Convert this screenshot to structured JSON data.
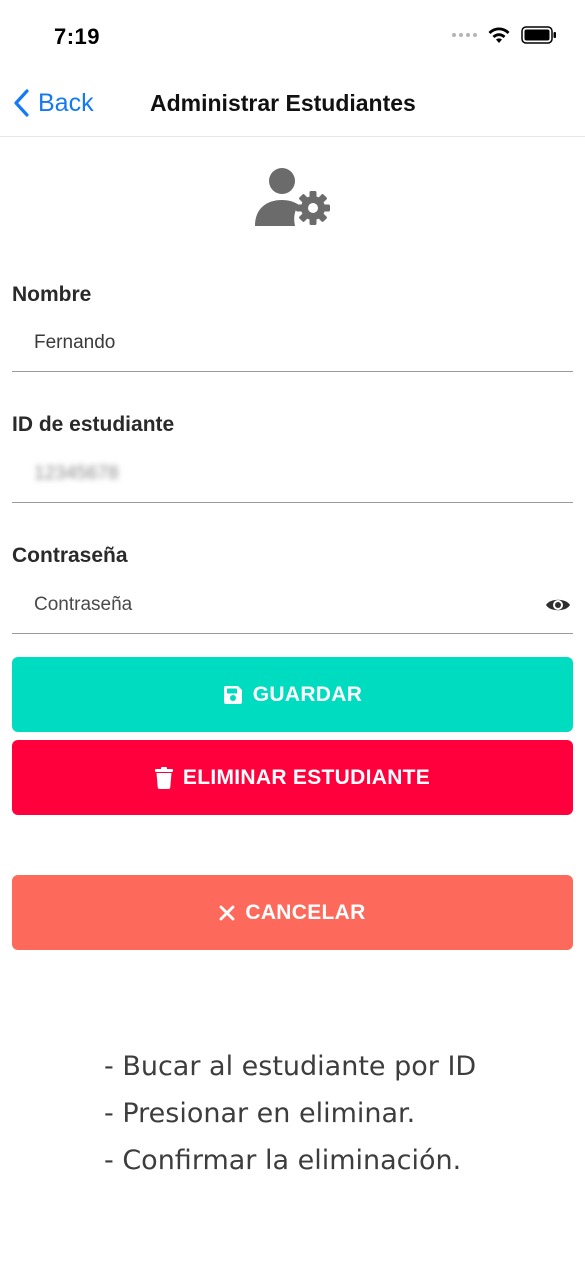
{
  "status_bar": {
    "time": "7:19"
  },
  "nav": {
    "back_label": "Back",
    "title": "Administrar Estudiantes"
  },
  "hero": {
    "icon": "user-cog-icon"
  },
  "form": {
    "name": {
      "label": "Nombre",
      "value": "Fernando"
    },
    "student_id": {
      "label": "ID de estudiante",
      "value": "12345678"
    },
    "password": {
      "label": "Contraseña",
      "placeholder": "Contraseña"
    }
  },
  "buttons": {
    "save": {
      "label": "GUARDAR",
      "icon": "floppy-disk-icon",
      "color": "#00dcbf"
    },
    "delete": {
      "label": "ELIMINAR ESTUDIANTE",
      "icon": "trash-icon",
      "color": "#ff003c"
    },
    "cancel": {
      "label": "CANCELAR",
      "icon": "close-icon",
      "color": "#fd6a5b"
    }
  },
  "instructions": [
    "- Bucar al estudiante por ID",
    "- Presionar en eliminar.",
    "- Confirmar la eliminación."
  ],
  "colors": {
    "accent": "#1479f3"
  }
}
